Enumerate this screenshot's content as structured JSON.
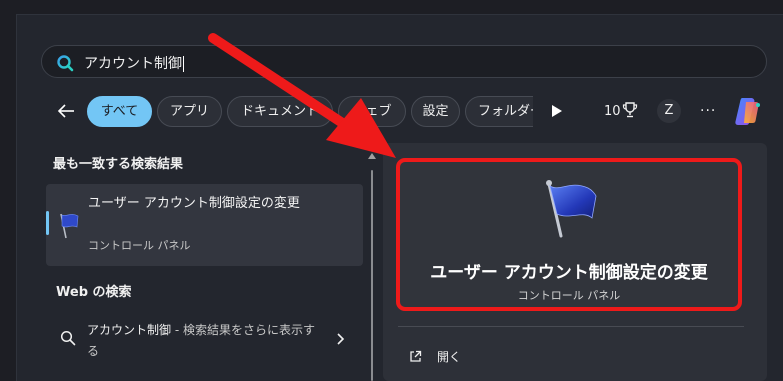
{
  "search": {
    "query": "アカウント制御"
  },
  "filters": [
    {
      "label": "すべて",
      "active": true
    },
    {
      "label": "アプリ",
      "active": false
    },
    {
      "label": "ドキュメント",
      "active": false
    },
    {
      "label": "ウェブ",
      "active": false
    },
    {
      "label": "設定",
      "active": false
    },
    {
      "label": "フォルダー",
      "active": false
    }
  ],
  "toolbar": {
    "points": "10",
    "avatar_letter": "Z",
    "more": "···"
  },
  "results": {
    "best_match_heading": "最も一致する検索結果",
    "best_match": {
      "title": "ユーザー アカウント制御設定の変更",
      "subtitle": "コントロール パネル",
      "icon": "flag-icon"
    },
    "web_heading": "Web の検索",
    "web_item": {
      "query": "アカウント制御",
      "hint": " - 検索結果をさらに表示する"
    }
  },
  "preview": {
    "title": "ユーザー アカウント制御設定の変更",
    "subtitle": "コントロール パネル",
    "action_open": "開く"
  },
  "colors": {
    "accent": "#73c6f5",
    "highlight_red": "#ee1a1a",
    "background": "#23262e"
  }
}
